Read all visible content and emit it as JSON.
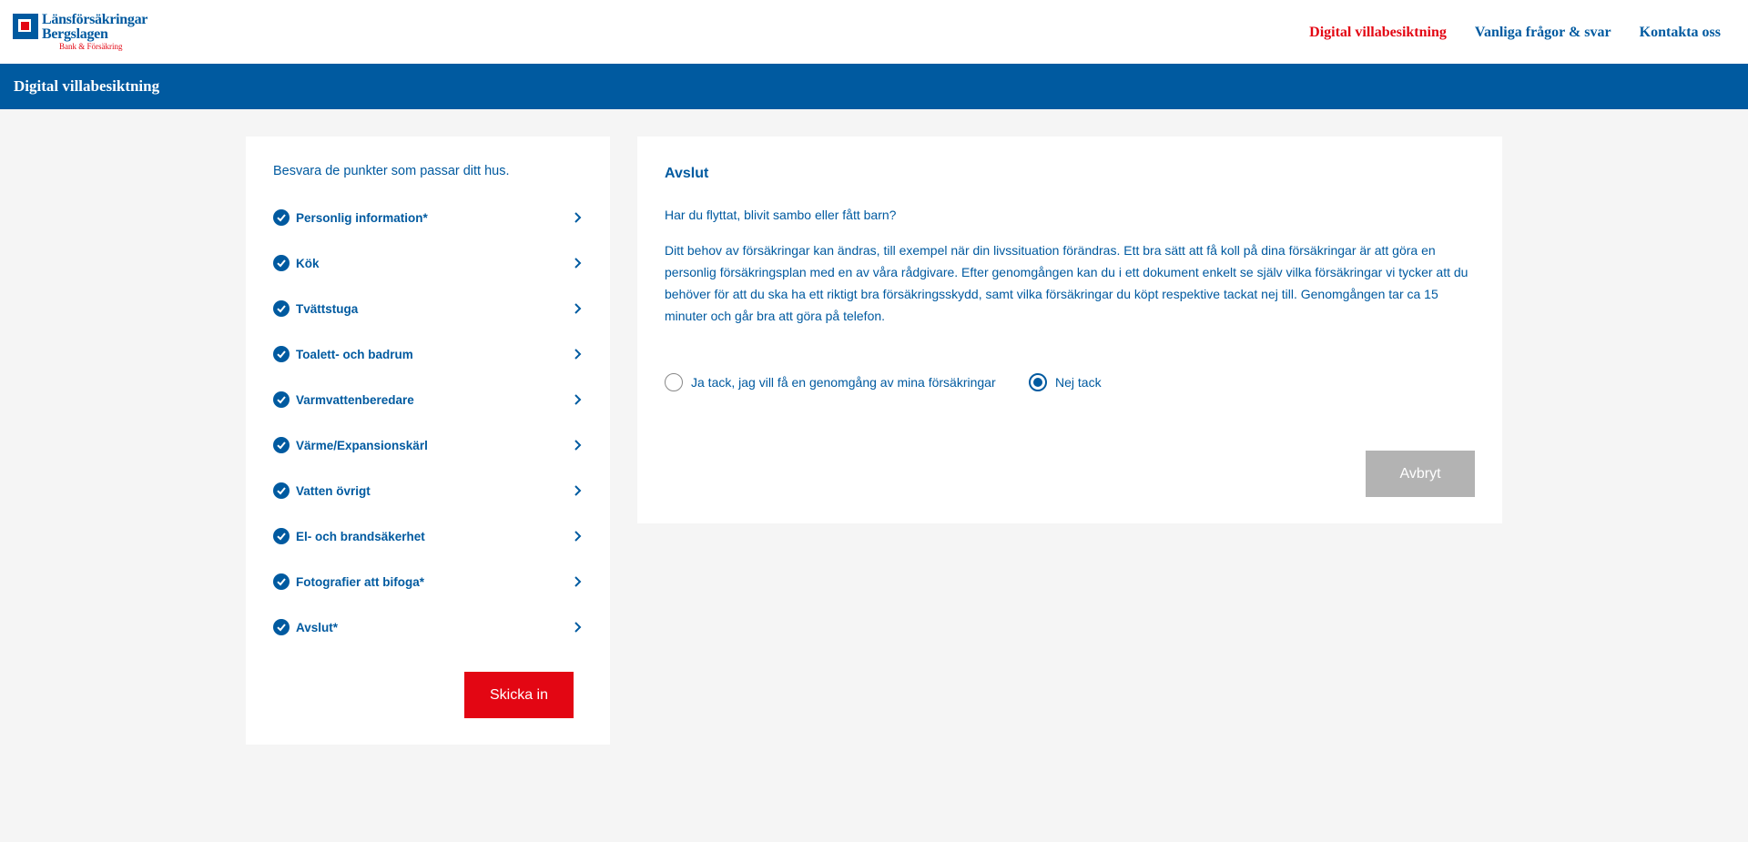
{
  "logo": {
    "line1": "Länsförsäkringar",
    "line2": "Bergslagen",
    "line3": "Bank & Försäkring"
  },
  "topnav": {
    "items": [
      {
        "label": "Digital villabesiktning",
        "active": true
      },
      {
        "label": "Vanliga frågor & svar",
        "active": false
      },
      {
        "label": "Kontakta oss",
        "active": false
      }
    ]
  },
  "banner": {
    "title": "Digital villabesiktning"
  },
  "sidebar": {
    "intro": "Besvara de punkter som passar ditt hus.",
    "items": [
      {
        "label": "Personlig information*",
        "completed": true
      },
      {
        "label": "Kök",
        "completed": true
      },
      {
        "label": "Tvättstuga",
        "completed": true
      },
      {
        "label": "Toalett- och badrum",
        "completed": true
      },
      {
        "label": "Varmvattenberedare",
        "completed": true
      },
      {
        "label": "Värme/Expansionskärl",
        "completed": true
      },
      {
        "label": "Vatten övrigt",
        "completed": true
      },
      {
        "label": "El- och brandsäkerhet",
        "completed": true
      },
      {
        "label": "Fotografier att bifoga*",
        "completed": true
      },
      {
        "label": "Avslut*",
        "completed": true
      }
    ],
    "submit_label": "Skicka in"
  },
  "main": {
    "title": "Avslut",
    "question": "Har du flyttat, blivit sambo eller fått barn?",
    "paragraph": "Ditt behov av försäkringar kan ändras, till exempel när din livssituation förändras. Ett bra sätt att få koll på dina försäkringar är att göra en personlig försäkringsplan med en av våra rådgivare. Efter genomgången kan du i ett dokument enkelt se själv vilka försäkringar vi tycker att du behöver för att du ska ha ett riktigt bra försäkringsskydd, samt vilka försäkringar du köpt respektive tackat nej till. Genomgången tar ca 15 minuter och går bra att göra på telefon.",
    "options": [
      {
        "label": "Ja tack, jag vill få en genomgång av mina försäkringar",
        "selected": false
      },
      {
        "label": "Nej tack",
        "selected": true
      }
    ],
    "cancel_label": "Avbryt"
  },
  "colors": {
    "primary_blue": "#005aa0",
    "brand_red": "#e30613",
    "page_bg": "#f5f5f5",
    "disabled_gray": "#b3b3b3"
  }
}
